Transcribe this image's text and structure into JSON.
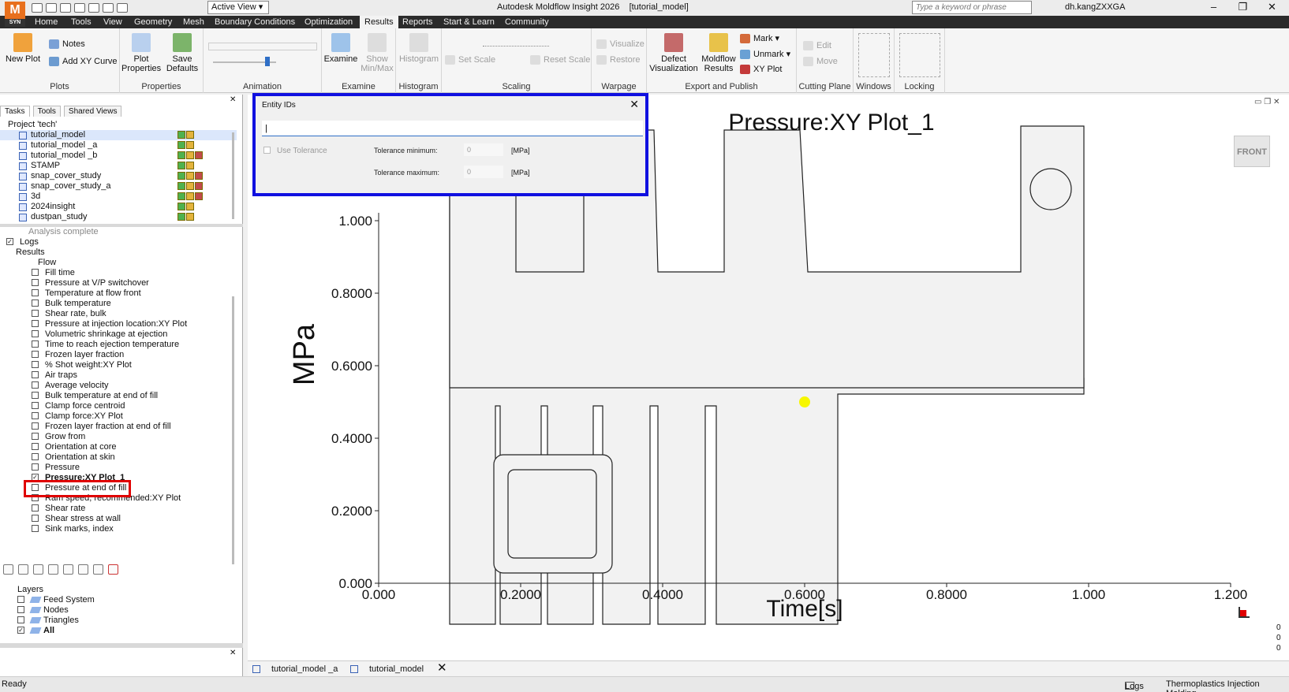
{
  "window": {
    "app_logo": "M",
    "app_logo_sub": "SYN",
    "title": "Autodesk Moldflow Insight 2026",
    "document": "[tutorial_model]",
    "active_view": "Active View",
    "search_placeholder": "Type a keyword or phrase",
    "user": "dh.kangZXXGA",
    "controls": [
      "–",
      "❐",
      "✕"
    ]
  },
  "menu": {
    "tabs": [
      "Home",
      "Tools",
      "View",
      "Geometry",
      "Mesh",
      "Boundary Conditions",
      "Optimization",
      "Results",
      "Reports",
      "Start & Learn",
      "Community"
    ],
    "active": "Results"
  },
  "ribbon": {
    "groups": [
      "Plots",
      "Properties",
      "Animation",
      "Examine",
      "Histogram",
      "Scaling",
      "Warpage",
      "Export and Publish",
      "Cutting Plane",
      "Windows",
      "Locking"
    ],
    "plots": {
      "new_plot": "New Plot",
      "notes": "Notes",
      "add_xy_curve": "Add XY Curve"
    },
    "properties": {
      "plot_properties": "Plot Properties",
      "save_defaults": "Save Defaults"
    },
    "examine": {
      "examine": "Examine",
      "show_minmax": "Show Min/Max"
    },
    "histogram": {
      "histogram": "Histogram"
    },
    "scaling": {
      "set_scale": "Set Scale",
      "reset_scale": "Reset Scale"
    },
    "warpage": {
      "visualize": "Visualize",
      "restore": "Restore"
    },
    "export": {
      "defect_visualization": "Defect Visualization",
      "moldflow_results": "Moldflow Results",
      "mark": "Mark",
      "unmark": "Unmark",
      "xy_plot": "XY Plot"
    },
    "cutting": {
      "edit": "Edit",
      "move": "Move"
    }
  },
  "left_panel": {
    "tabs": [
      "Tasks",
      "Tools",
      "Shared Views"
    ],
    "project_label": "Project 'tech'",
    "projects": [
      "tutorial_model",
      "tutorial_model _a",
      "tutorial_model _b",
      "STAMP",
      "snap_cover_study",
      "snap_cover_study_a",
      "3d",
      "2024insight",
      "dustpan_study"
    ],
    "analysis_status": "Analysis complete",
    "logs": "Logs",
    "results": "Results",
    "flow": "Flow",
    "result_items": [
      "Fill time",
      "Pressure at V/P switchover",
      "Temperature at flow front",
      "Bulk temperature",
      "Shear rate, bulk",
      "Pressure at injection location:XY Plot",
      "Volumetric shrinkage at ejection",
      "Time to reach ejection temperature",
      "Frozen layer fraction",
      "% Shot weight:XY Plot",
      "Air traps",
      "Average velocity",
      "Bulk temperature at end of fill",
      "Clamp force centroid",
      "Clamp force:XY Plot",
      "Frozen layer fraction at end of fill",
      "Grow from",
      "Orientation at core",
      "Orientation at skin",
      "Pressure",
      "Pressure:XY Plot_1",
      "Pressure at end of fill",
      "Ram speed, recommended:XY Plot",
      "Shear rate",
      "Shear stress at wall",
      "Sink marks, index"
    ],
    "checked_item": "Pressure:XY Plot_1",
    "layers_label": "Layers",
    "layers": [
      "Feed System",
      "Nodes",
      "Triangles",
      "All"
    ]
  },
  "dialog": {
    "title": "Entity IDs",
    "input_value": "|",
    "use_tolerance": "Use Tolerance",
    "tol_min_label": "Tolerance minimum:",
    "tol_min_value": "0",
    "tol_max_label": "Tolerance maximum:",
    "tol_max_value": "0",
    "unit": "[MPa]"
  },
  "viewport": {
    "view_cube": "FRONT",
    "triad_values": [
      "0",
      "0",
      "0"
    ]
  },
  "chart_data": {
    "type": "line",
    "title": "Pressure:XY Plot_1",
    "xlabel": "Time[s]",
    "ylabel": "MPa",
    "xlim": [
      0,
      1.2
    ],
    "ylim": [
      0,
      1.0
    ],
    "x_ticks": [
      "0.000",
      "0.2000",
      "0.4000",
      "0.6000",
      "0.8000",
      "1.000",
      "1.200"
    ],
    "y_ticks": [
      "0.000",
      "0.2000",
      "0.4000",
      "0.6000",
      "0.8000",
      "1.000"
    ],
    "marker": {
      "x": 0.6,
      "y": 0.5,
      "color": "#f7f700"
    },
    "series": [],
    "grid": false
  },
  "doc_tabs": [
    "tutorial_model _a",
    "tutorial_model"
  ],
  "status": {
    "left": "Ready",
    "logs": "Logs",
    "mode": "Thermoplastics Injection Molding"
  },
  "colors": {
    "accent": "#1010e0",
    "highlight": "#e00000",
    "menu_bg": "#2b2b2b",
    "logo": "#e8701d"
  }
}
